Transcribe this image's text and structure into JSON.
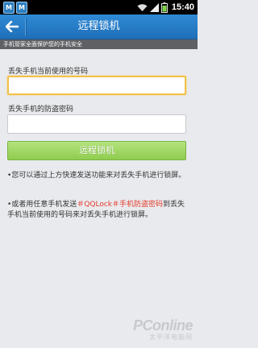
{
  "status_bar": {
    "app_icons": [
      "M",
      "M"
    ],
    "time": "15:40"
  },
  "header": {
    "title": "远程锁机",
    "subtitle": "手机管家全面保护您的手机安全"
  },
  "form": {
    "phone_label": "丢失手机当前使用的号码",
    "phone_value": "",
    "password_label": "丢失手机的防盗密码",
    "password_value": "",
    "submit_label": "远程锁机"
  },
  "tips": {
    "tip1": "•您可以通过上方快速发送功能来对丢失手机进行锁屏。",
    "tip2_prefix": "•或者用任意手机发送",
    "tip2_command": "＃QQLock＃手机防盗密码",
    "tip2_suffix": "到丢失手机当前使用的号码来对丢失手机进行锁屏。"
  },
  "watermark": {
    "main": "PConline",
    "sub": "太平洋电脑网"
  },
  "colors": {
    "title_bar": "#2579c6",
    "button_green": "#a2d865",
    "command_red": "#e33b2c",
    "input_focus": "#f2c14b"
  }
}
